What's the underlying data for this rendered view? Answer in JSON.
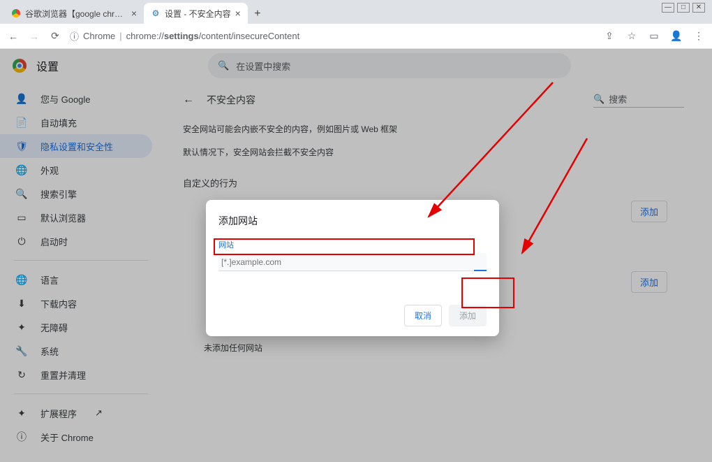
{
  "window": {
    "min": "—",
    "max": "□",
    "close": "✕"
  },
  "tabs": [
    {
      "title": "谷歌浏览器【google chrome】"
    },
    {
      "title": "设置 - 不安全内容"
    }
  ],
  "omnibox": {
    "chrome_label": "Chrome",
    "url_prefix": "chrome://",
    "url_bold": "settings",
    "url_rest": "/content/insecureContent"
  },
  "header": {
    "title": "设置",
    "search_placeholder": "在设置中搜索"
  },
  "sidebar": {
    "items": [
      {
        "icon": "👤",
        "label": "您与 Google"
      },
      {
        "icon": "📄",
        "label": "自动填充"
      },
      {
        "icon": "🛡",
        "label": "隐私设置和安全性"
      },
      {
        "icon": "🌐",
        "label": "外观"
      },
      {
        "icon": "🔍",
        "label": "搜索引擎"
      },
      {
        "icon": "▭",
        "label": "默认浏览器"
      },
      {
        "icon": "⏻",
        "label": "启动时"
      }
    ],
    "items2": [
      {
        "icon": "🌐",
        "label": "语言"
      },
      {
        "icon": "⬇",
        "label": "下载内容"
      },
      {
        "icon": "✦",
        "label": "无障碍"
      },
      {
        "icon": "🔧",
        "label": "系统"
      },
      {
        "icon": "↻",
        "label": "重置并清理"
      }
    ],
    "items3": [
      {
        "icon": "✦",
        "label": "扩展程序",
        "ext": "↗"
      },
      {
        "icon": "ⓘ",
        "label": "关于 Chrome"
      }
    ]
  },
  "page": {
    "back": "←",
    "title": "不安全内容",
    "search_icon": "🔍",
    "search_label": "搜索",
    "p1": "安全网站可能会内嵌不安全的内容，例如图片或 Web 框架",
    "p2": "默认情况下，安全网站会拦截不安全内容",
    "custom_title": "自定义的行为",
    "add_button": "添加",
    "no_sites": "未添加任何网站"
  },
  "dialog": {
    "title": "添加网站",
    "field_label": "网站",
    "placeholder": "[*.]example.com",
    "cancel": "取消",
    "add": "添加"
  }
}
